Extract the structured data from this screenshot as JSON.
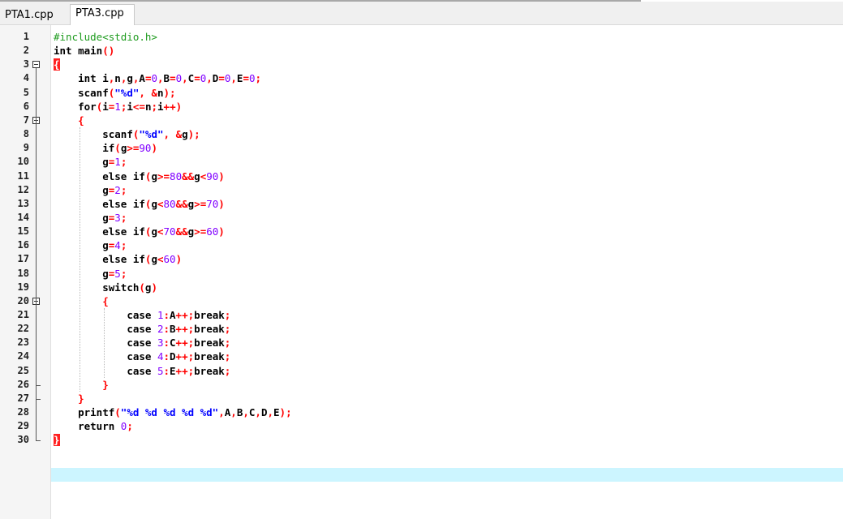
{
  "tabs": [
    {
      "label": "PTA1.cpp",
      "active": false
    },
    {
      "label": "PTA3.cpp",
      "active": true
    }
  ],
  "line_numbers": [
    "1",
    "2",
    "3",
    "4",
    "5",
    "6",
    "7",
    "8",
    "9",
    "10",
    "11",
    "12",
    "13",
    "14",
    "15",
    "16",
    "17",
    "18",
    "19",
    "20",
    "21",
    "22",
    "23",
    "24",
    "25",
    "26",
    "27",
    "28",
    "29",
    "30"
  ],
  "current_line": 30,
  "code_lines": [
    "#include<stdio.h>",
    "int main()",
    "{",
    "    int i,n,g,A=0,B=0,C=0,D=0,E=0;",
    "    scanf(\"%d\", &n);",
    "    for(i=1;i<=n;i++)",
    "    {",
    "        scanf(\"%d\", &g);",
    "        if(g>=90)",
    "        g=1;",
    "        else if(g>=80&&g<90)",
    "        g=2;",
    "        else if(g<80&&g>=70)",
    "        g=3;",
    "        else if(g<70&&g>=60)",
    "        g=4;",
    "        else if(g<60)",
    "        g=5;",
    "        switch(g)",
    "        {",
    "            case 1:A++;break;",
    "            case 2:B++;break;",
    "            case 3:C++;break;",
    "            case 4:D++;break;",
    "            case 5:E++;break;",
    "        }",
    "    }",
    "    printf(\"%d %d %d %d %d\",A,B,C,D,E);",
    "    return 0;",
    "}"
  ],
  "colors": {
    "preprocessor": "#1e9b1e",
    "operator": "#ff0000",
    "number": "#8000ff",
    "string": "#0000ff",
    "current_line_bg": "#ccf5ff",
    "brace_match_bg": "#ff2020"
  }
}
